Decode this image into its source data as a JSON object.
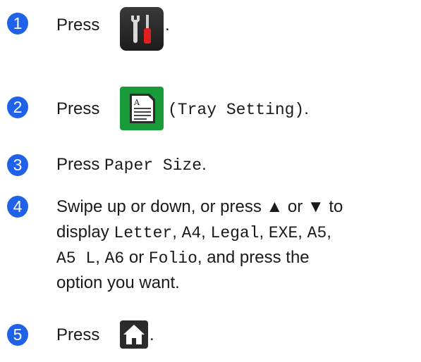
{
  "steps": [
    {
      "number": "1",
      "parts": {
        "a": "Press",
        "b": "."
      },
      "icon": "settings-tools-icon"
    },
    {
      "number": "2",
      "parts": {
        "a": "Press",
        "b": "(Tray Setting)",
        "c": "."
      },
      "icon": "tray-setting-icon"
    },
    {
      "number": "3",
      "parts": {
        "a": "Press",
        "b": "Paper Size",
        "c": "."
      }
    },
    {
      "number": "4",
      "lines": {
        "l1": "Swipe up or down, or press ▲ or ▼ to",
        "l2a": "display",
        "l2b": "Letter",
        "l2c": ", ",
        "l2d": "A4",
        "l2e": ", ",
        "l2f": "Legal",
        "l2g": ", ",
        "l2h": "EXE",
        "l2i": ", ",
        "l2j": "A5",
        "l2k": ",",
        "l3a": "A5 L",
        "l3b": ", ",
        "l3c": "A6",
        "l3d": " or ",
        "l3e": "Folio",
        "l3f": ", and press the",
        "l4": "option you want."
      }
    },
    {
      "number": "5",
      "parts": {
        "a": "Press",
        "b": "."
      },
      "icon": "home-icon"
    }
  ],
  "colors": {
    "step_badge": "#1f62e8",
    "icon_bg": "#2b2b2b",
    "tray_icon_bg": "#1a9b3a"
  }
}
